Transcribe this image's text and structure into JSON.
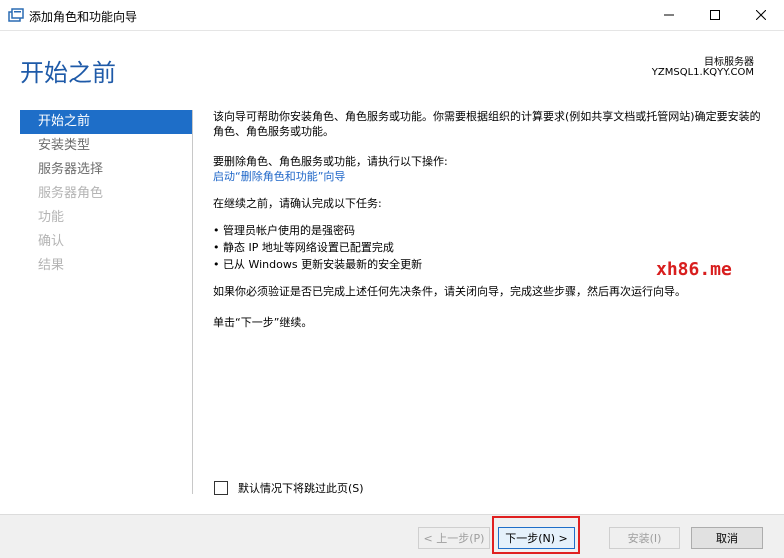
{
  "window": {
    "title": "添加角色和功能向导"
  },
  "header": {
    "page_title": "开始之前",
    "target_label": "目标服务器",
    "target_server": "YZMSQL1.KQYY.COM"
  },
  "nav": {
    "items": [
      {
        "label": "开始之前",
        "state": "active"
      },
      {
        "label": "安装类型",
        "state": "enabled"
      },
      {
        "label": "服务器选择",
        "state": "enabled"
      },
      {
        "label": "服务器角色",
        "state": "disabled"
      },
      {
        "label": "功能",
        "state": "disabled"
      },
      {
        "label": "确认",
        "state": "disabled"
      },
      {
        "label": "结果",
        "state": "disabled"
      }
    ]
  },
  "content": {
    "p1": "该向导可帮助你安装角色、角色服务或功能。你需要根据组织的计算要求(例如共享文档或托管网站)确定要安装的角色、角色服务或功能。",
    "p2": "要删除角色、角色服务或功能，请执行以下操作:",
    "link": "启动“删除角色和功能”向导",
    "p3": "在继续之前，请确认完成以下任务:",
    "bullets": [
      "管理员帐户使用的是强密码",
      "静态 IP 地址等网络设置已配置完成",
      "已从 Windows 更新安装最新的安全更新"
    ],
    "p4": "如果你必须验证是否已完成上述任何先决条件，请关闭向导，完成这些步骤，然后再次运行向导。",
    "p5": "单击“下一步”继续。"
  },
  "watermark": "xh86.me",
  "skip_label": "默认情况下将跳过此页(S)",
  "buttons": {
    "prev": "< 上一步(P)",
    "next": "下一步(N) >",
    "install": "安装(I)",
    "cancel": "取消"
  },
  "colors": {
    "accent": "#1e6ec8",
    "title_blue": "#1e5aa8",
    "highlight_red": "#e02020"
  }
}
